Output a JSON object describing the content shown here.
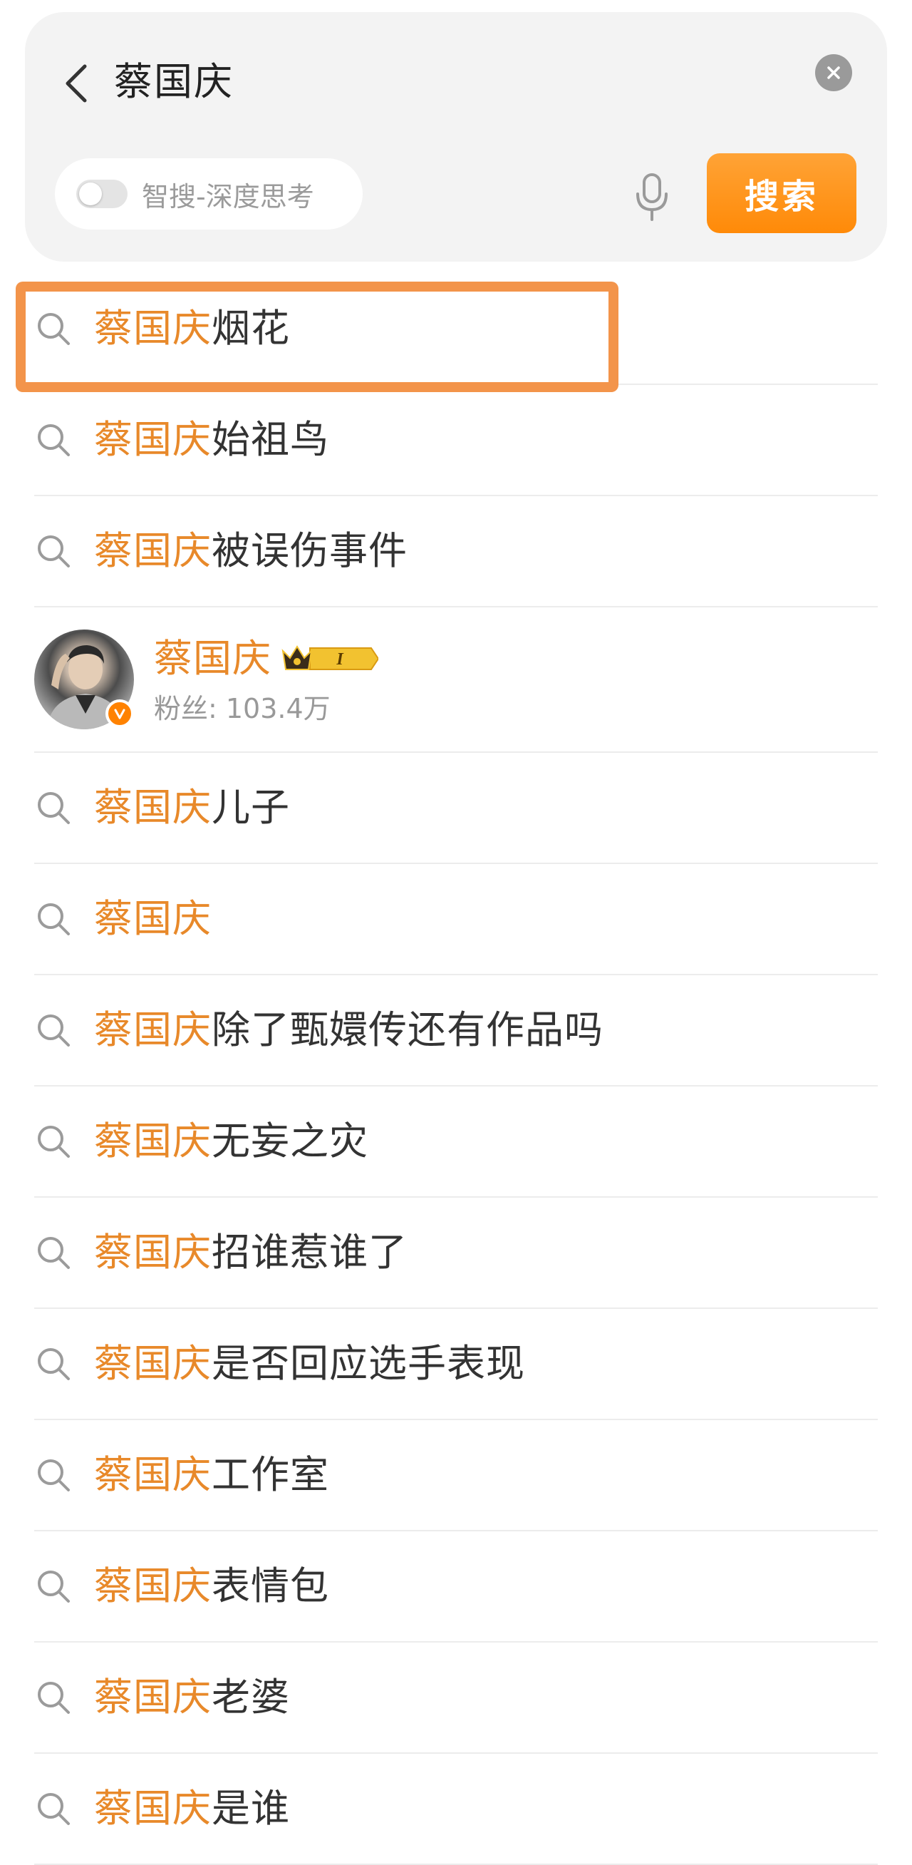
{
  "header": {
    "query": "蔡国庆",
    "smart_search_label": "智搜-深度思考",
    "search_button": "搜索"
  },
  "suggestions_top": [
    {
      "highlight": "蔡国庆",
      "rest": "烟花"
    },
    {
      "highlight": "蔡国庆",
      "rest": "始祖鸟"
    },
    {
      "highlight": "蔡国庆",
      "rest": "被误伤事件"
    }
  ],
  "user": {
    "name": "蔡国庆",
    "level_badge": "I",
    "fans": "粉丝: 103.4万"
  },
  "suggestions_bottom": [
    {
      "highlight": "蔡国庆",
      "rest": "儿子"
    },
    {
      "highlight": "蔡国庆",
      "rest": ""
    },
    {
      "highlight": "蔡国庆",
      "rest": "除了甄嬛传还有作品吗"
    },
    {
      "highlight": "蔡国庆",
      "rest": "无妄之灾"
    },
    {
      "highlight": "蔡国庆",
      "rest": "招谁惹谁了"
    },
    {
      "highlight": "蔡国庆",
      "rest": "是否回应选手表现"
    },
    {
      "highlight": "蔡国庆",
      "rest": "工作室"
    },
    {
      "highlight": "蔡国庆",
      "rest": "表情包"
    },
    {
      "highlight": "蔡国庆",
      "rest": "老婆"
    },
    {
      "highlight": "蔡国庆",
      "rest": "是谁"
    }
  ],
  "colors": {
    "accent": "#e8892a",
    "button": "#ff8a08",
    "highlight_box": "#f3944a"
  }
}
